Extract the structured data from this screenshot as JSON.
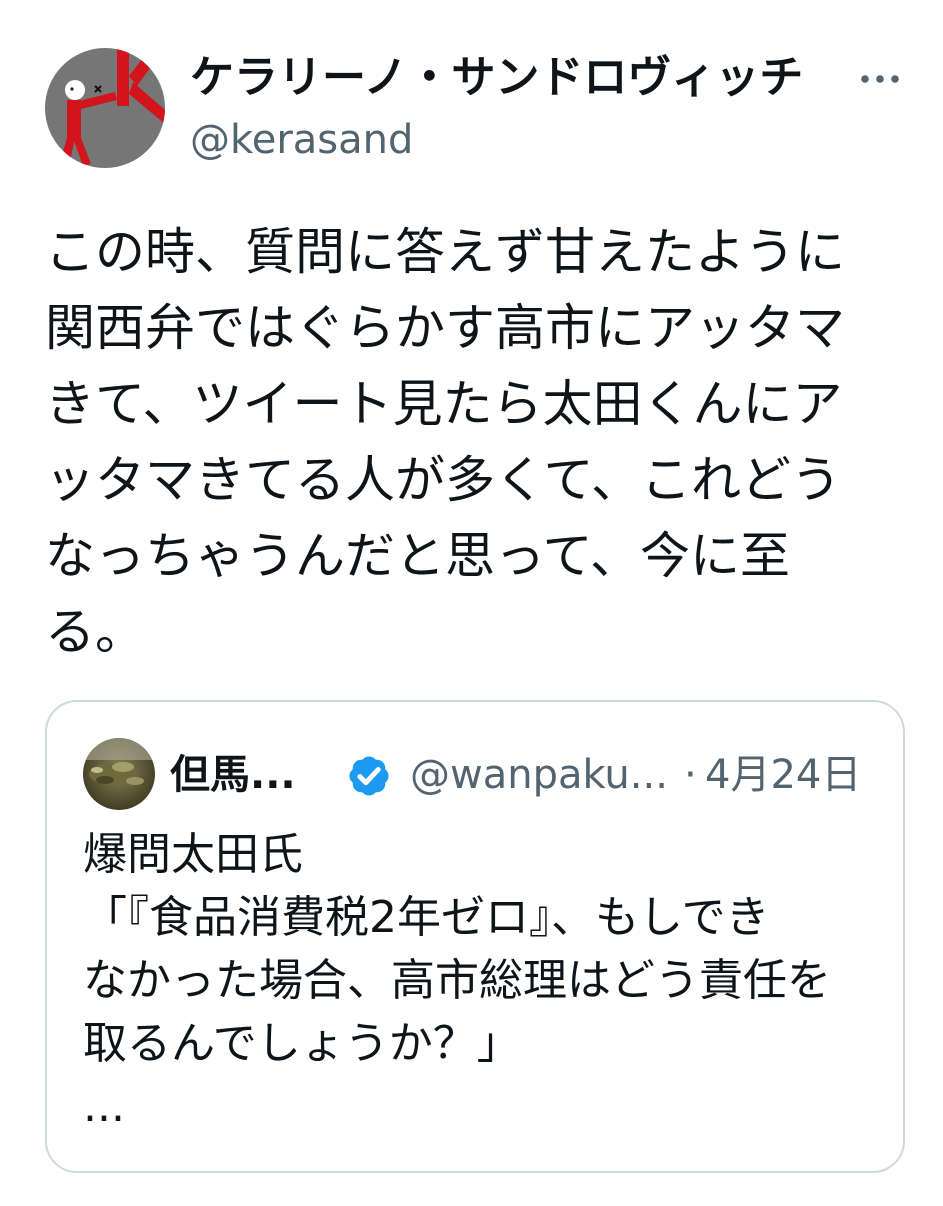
{
  "tweet": {
    "author": {
      "name": "ケラリーノ・サンドロヴィッチ",
      "handle": "@kerasand"
    },
    "lines": [
      "この時、質問に答えず甘えたように",
      "関西弁ではぐらかす高市にアッタマ",
      "きて、ツイート見たら太田くんにア",
      "ッタマきてる人が多くて、これどう",
      "なっちゃうんだと思って、今に至",
      "る。"
    ]
  },
  "quoted_tweet": {
    "author": {
      "name": "但馬...",
      "verified": true,
      "handle": "@wanpaku..."
    },
    "separator": "·",
    "date": "4月24日",
    "lines": [
      "爆問太田氏",
      "「『食品消費税2年ゼロ』、もしでき",
      "なかった場合、高市総理はどう責任を",
      "取るんでしょうか？」",
      "..."
    ]
  },
  "icons": {
    "more": "more-options-icon",
    "verified": "verified-badge-icon"
  },
  "colors": {
    "background": "#ffffff",
    "text": "#0f1419",
    "secondary_text": "#536471",
    "card_border": "#cfd9de",
    "verified_badge": "#1d9bf0"
  }
}
